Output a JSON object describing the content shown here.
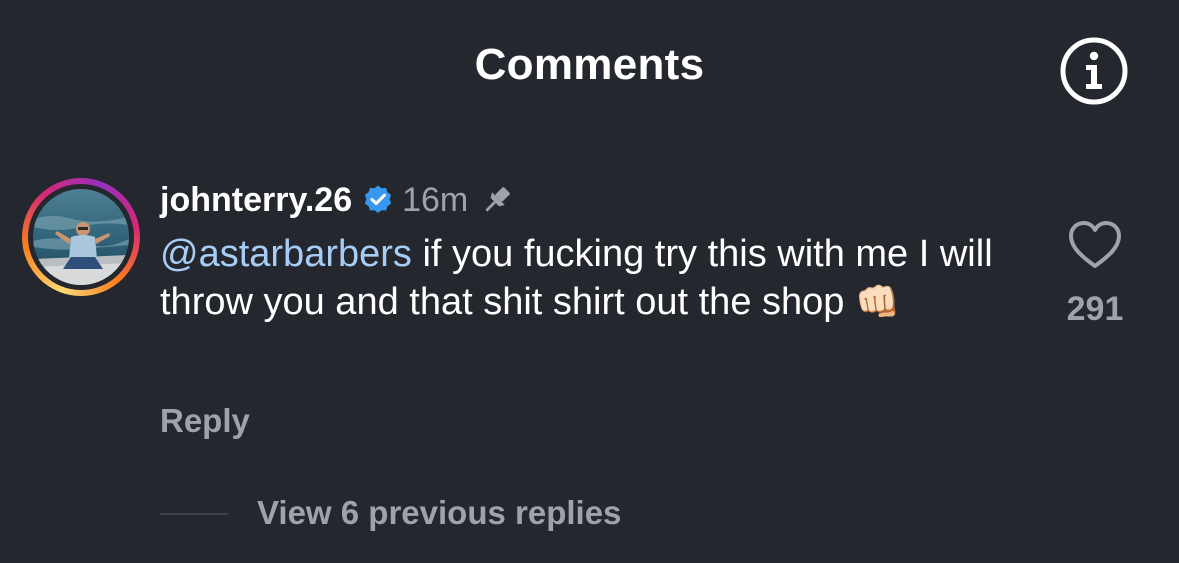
{
  "header": {
    "title": "Comments",
    "info_icon": "info-circle-icon"
  },
  "comment": {
    "avatar_icon": "profile-photo-avatar",
    "avatar_ring_colors": [
      "#feda75",
      "#fa7e1e",
      "#d62976",
      "#962fbf"
    ],
    "username": "johnterry.26",
    "verified_icon": "verified-badge-icon",
    "verified_color": "#3897f0",
    "timestamp": "16m",
    "pinned_icon": "pin-icon",
    "mention": "@astarbarbers",
    "mention_color": "#a7cdf7",
    "text": " if you fucking try this with me I will throw you and that shit shirt out the shop ",
    "emoji": "👊🏻",
    "reply_label": "Reply",
    "like_icon": "heart-outline-icon",
    "like_count": "291"
  },
  "replies": {
    "view_label": "View 6 previous replies"
  }
}
